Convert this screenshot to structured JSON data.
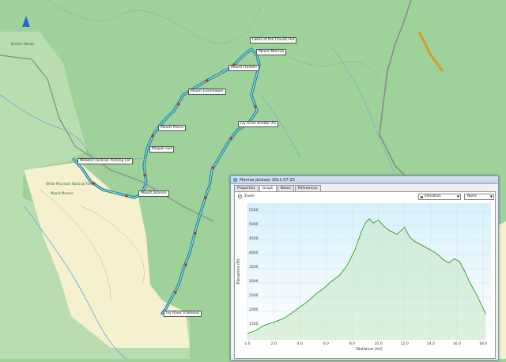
{
  "map": {
    "waypoints": [
      {
        "label": "Lakes of the Clouds Hut"
      },
      {
        "label": "Mount Monroe"
      },
      {
        "label": "Mount Franklin"
      },
      {
        "label": "Mount Eisenhower"
      },
      {
        "label": "Mount Pierce"
      },
      {
        "label": "Mizpah Hut"
      },
      {
        "label": "Webster-Jackson Parking Lot"
      },
      {
        "label": "Mount Jackson"
      },
      {
        "label": "Ivy River Shelter #1"
      },
      {
        "label": "Ivy River Trailhead"
      }
    ],
    "places": [
      "Bretton Woods",
      "Mount Monroe",
      "White Mountain National Forest"
    ],
    "route_color": "#2a8a9a",
    "forest_color": "#9fd19a",
    "private_land_color": "#f5f0d0"
  },
  "window": {
    "title": "Monroe Jackson 2011-07-25",
    "tabs": [
      "Properties",
      "Graph",
      "Notes",
      "References"
    ],
    "active_tab": "Graph",
    "zoom_label": "Zoom",
    "y_select": "Elevation",
    "secondary_select": "None"
  },
  "chart_data": {
    "type": "line",
    "xlabel": "Distance (mi)",
    "ylabel": "Elevation (ft)",
    "xlim": [
      0,
      18.6
    ],
    "ylim": [
      1000,
      5800
    ],
    "xticks": [
      "0.0",
      "2.0",
      "4.0",
      "6.0",
      "8.0",
      "10.0",
      "12.0",
      "14.0",
      "16.0",
      "18.0"
    ],
    "yticks": [
      "1500",
      "2000",
      "2500",
      "3000",
      "3500",
      "4000",
      "4500",
      "5000",
      "5500"
    ],
    "grid": true,
    "series_color": "#2a9a2a",
    "x": [
      0,
      0.6,
      1.2,
      2.0,
      2.8,
      3.4,
      4.0,
      4.6,
      5.2,
      5.8,
      6.4,
      7.0,
      7.6,
      8.2,
      8.7,
      9.0,
      9.3,
      9.6,
      10.0,
      10.4,
      10.8,
      11.4,
      12.0,
      12.4,
      12.8,
      13.2,
      13.8,
      14.4,
      15.0,
      15.4,
      15.8,
      16.2,
      16.6,
      17.0,
      17.6,
      18.2
    ],
    "y": [
      1230,
      1320,
      1500,
      1620,
      1760,
      1950,
      2150,
      2350,
      2600,
      2800,
      3050,
      3250,
      3600,
      4150,
      4800,
      5100,
      5250,
      5100,
      5200,
      5000,
      4850,
      4700,
      4950,
      4600,
      4450,
      4350,
      4200,
      4050,
      3800,
      3700,
      3850,
      3750,
      3400,
      3000,
      2500,
      1900
    ]
  }
}
